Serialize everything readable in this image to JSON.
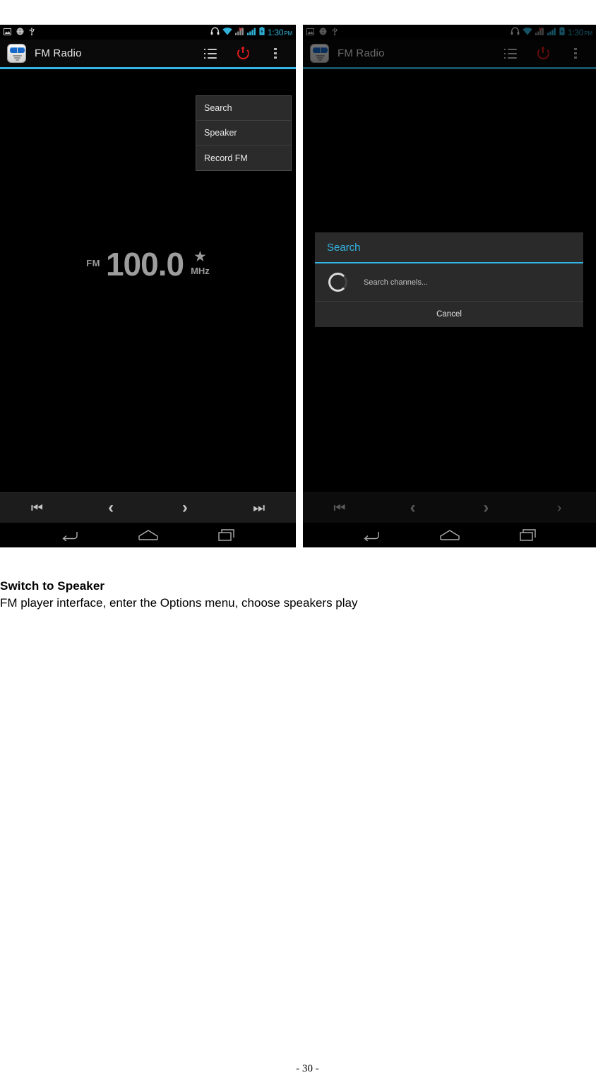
{
  "page": {
    "footer": "- 30 -"
  },
  "caption": {
    "heading": "Switch to Speaker",
    "body": "FM player interface, enter the Options menu, choose speakers play"
  },
  "colors": {
    "accent_cyan": "#33b5e5",
    "power_red": "#e01b1b",
    "status_clock": "#2fb3d9",
    "screen_bg": "#000000",
    "dialog_bg": "#2a2a2a",
    "menu_bg": "#2b2b2b"
  },
  "phone_left": {
    "statusbar": {
      "left_icons": [
        "screenshot-icon",
        "browser-globe-icon",
        "usb-icon"
      ],
      "right_icons": [
        "headset-icon",
        "wifi-icon",
        "sim1-signal-icon",
        "sim2-signal-icon",
        "battery-icon"
      ],
      "clock": "1:30",
      "ampm": "PM"
    },
    "actionbar": {
      "app_icon": "fm-radio-app-icon",
      "title": "FM Radio",
      "actions": [
        {
          "name": "channel-list-icon",
          "label": "Channel list"
        },
        {
          "name": "power-icon",
          "label": "Power"
        },
        {
          "name": "overflow-menu-icon",
          "label": "More options"
        }
      ]
    },
    "menu": {
      "items": [
        {
          "label": "Search"
        },
        {
          "label": "Speaker"
        },
        {
          "label": "Record FM"
        }
      ]
    },
    "player": {
      "band": "FM",
      "frequency": "100.0",
      "favorite_glyph": "★",
      "unit": "MHz"
    },
    "transport": {
      "buttons": [
        {
          "name": "prev-channel-button",
          "glyph": "⏮"
        },
        {
          "name": "tune-down-button",
          "glyph": "‹"
        },
        {
          "name": "tune-up-button",
          "glyph": "›"
        },
        {
          "name": "next-channel-button",
          "glyph": "⏭"
        }
      ]
    },
    "navbar": {
      "buttons": [
        {
          "name": "nav-back-button"
        },
        {
          "name": "nav-home-button"
        },
        {
          "name": "nav-recents-button"
        }
      ]
    }
  },
  "phone_right": {
    "statusbar": {
      "clock": "1:30",
      "ampm": "PM"
    },
    "actionbar": {
      "title": "FM Radio"
    },
    "dialog": {
      "title": "Search",
      "message": "Search channels...",
      "cancel_label": "Cancel",
      "spinner": "progress-spinner"
    },
    "transport": {
      "buttons": [
        {
          "name": "prev-channel-button",
          "glyph": "⏮"
        },
        {
          "name": "tune-down-button",
          "glyph": "‹"
        },
        {
          "name": "tune-up-button",
          "glyph": "›"
        },
        {
          "name": "next-channel-button",
          "glyph": "›"
        }
      ]
    }
  }
}
